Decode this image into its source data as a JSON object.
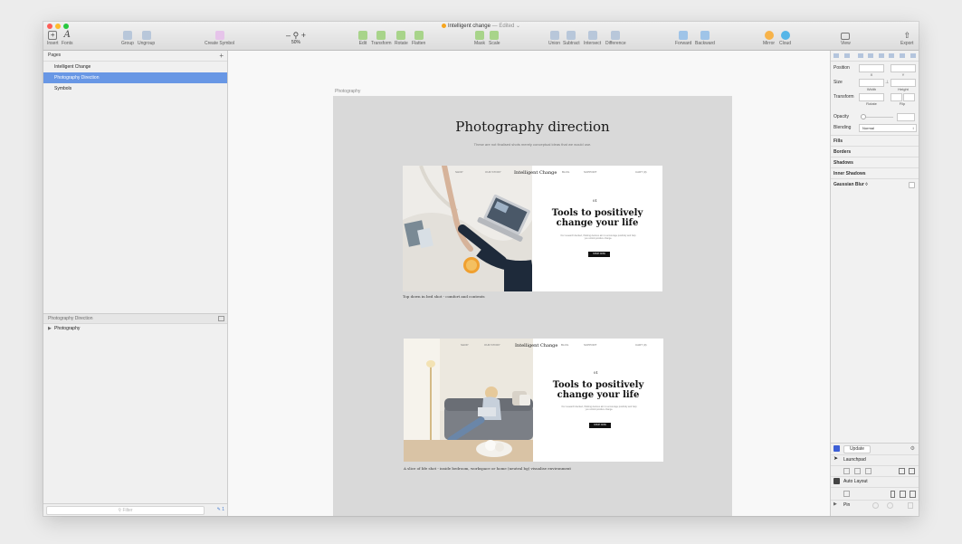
{
  "window": {
    "title": "Intelligent change",
    "separator": "—",
    "status": "Edited ⌄"
  },
  "toolbar": {
    "insert": "Insert",
    "fonts": "Fonts",
    "group": "Group",
    "ungroup": "Ungroup",
    "create_symbol": "Create Symbol",
    "zoom_minus": "–",
    "zoom_plus": "+",
    "zoom_level": "50%",
    "edit": "Edit",
    "transform": "Transform",
    "rotate": "Rotate",
    "flatten": "Flatten",
    "mask": "Mask",
    "scale": "Scale",
    "union": "Union",
    "subtract": "Subtract",
    "intersect": "Intersect",
    "difference": "Difference",
    "forward": "Forward",
    "backward": "Backward",
    "mirror": "Mirror",
    "cloud": "Cloud",
    "view": "View",
    "export": "Export"
  },
  "pages": {
    "header": "Pages",
    "add": "+",
    "items": [
      "Intelligent Change",
      "Photography Direction",
      "Symbols"
    ],
    "selected_index": 1
  },
  "layers": {
    "header": "Photography Direction",
    "items": [
      "Photography"
    ]
  },
  "filter": {
    "placeholder": "Filter",
    "count": "1"
  },
  "canvas": {
    "artboard_label": "Photography",
    "title": "Photography direction",
    "subtitle": "These are not finalised shots merely conceptual ideas that we would use.",
    "mocks": [
      {
        "nav": [
          "SHOP",
          "OUR STORY",
          "BLOG",
          "SUPPORT",
          "CART (0)"
        ],
        "brand": "Intelligent Change",
        "number": "01",
        "headline": "Tools to positively change your life",
        "body": "Our research-backed, thinking devices aim to encourage positivity and help you unlock positive change.",
        "cta": "SHOP NOW",
        "caption": "Top down in bed shot - comfort and contents"
      },
      {
        "nav": [
          "SHOP",
          "OUR STORY",
          "BLOG",
          "SUPPORT",
          "CART (0)"
        ],
        "brand": "Intelligent Change",
        "number": "01",
        "headline": "Tools to positively change your life",
        "body": "Our research-backed, thinking devices aim to encourage positivity and help you unlock positive change.",
        "cta": "SHOP NOW",
        "caption": "A slice of life shot - inside bedroom, workspace or home (neutral bg) visualise environment"
      }
    ]
  },
  "inspector": {
    "position": "Position",
    "x": "X",
    "y": "Y",
    "size": "Size",
    "width": "Width",
    "height": "Height",
    "transform": "Transform",
    "rotate": "Rotate",
    "flip": "Flip",
    "opacity": "Opacity",
    "blending": "Blending",
    "blending_value": "Normal",
    "fills": "Fills",
    "borders": "Borders",
    "shadows": "Shadows",
    "inner_shadows": "Inner Shadows",
    "gaussian_blur": "Gaussian Blur ◊"
  },
  "plugins": {
    "update": "Update",
    "launchpad": "Launchpad",
    "auto_layout": "Auto Layout",
    "pin": "Pin"
  },
  "colors": {
    "selection": "#6897e5",
    "artboard_bg": "#d9d9d9",
    "accent_green": "#8bc34a",
    "accent_blue": "#5aa0e0"
  }
}
